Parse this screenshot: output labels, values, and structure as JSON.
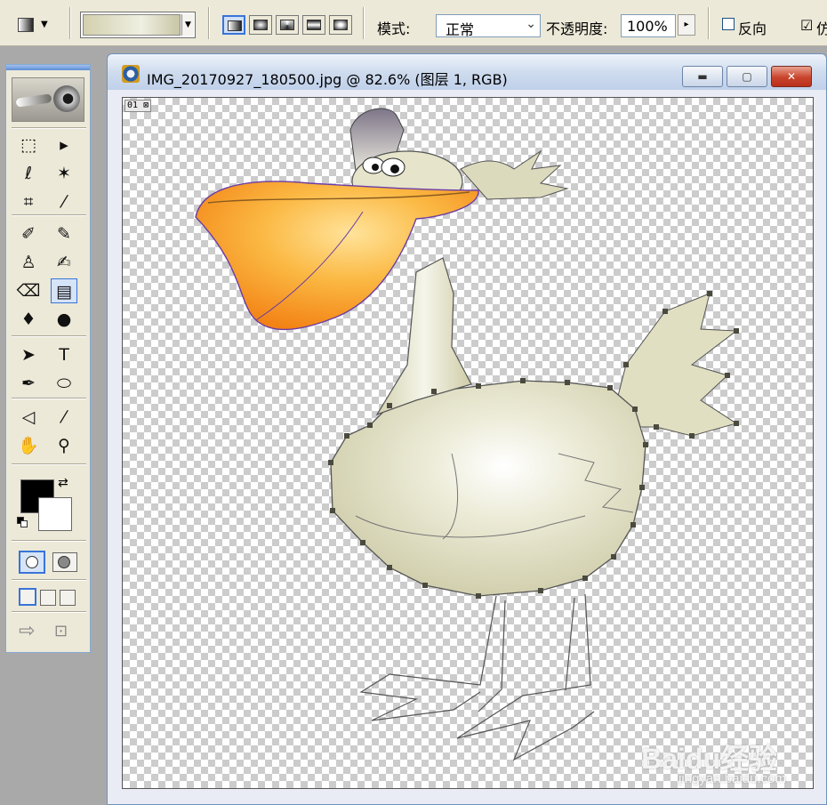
{
  "options_bar": {
    "mode_label": "模式:",
    "mode_value": "正常",
    "opacity_label": "不透明度:",
    "opacity_value": "100%",
    "reverse_label": "反向",
    "dither_checked_mark": "☑",
    "dither_partial": "仿"
  },
  "document": {
    "title": "IMG_20170927_180500.jpg @ 82.6% (图层 1, RGB)",
    "zoom_percent": 82.6,
    "layer_indicator": "01",
    "window_buttons": {
      "minimize": "▬",
      "maximize": "▢",
      "close": "✕"
    }
  },
  "toolbox": {
    "tools": [
      {
        "name": "marquee",
        "glyph": "⬚"
      },
      {
        "name": "move",
        "glyph": "▸"
      },
      {
        "name": "lasso",
        "glyph": "ℓ"
      },
      {
        "name": "magic-wand",
        "glyph": "✶"
      },
      {
        "name": "crop",
        "glyph": "⌗"
      },
      {
        "name": "slice",
        "glyph": "⁄"
      },
      {
        "name": "healing",
        "glyph": "✐"
      },
      {
        "name": "brush",
        "glyph": "✎"
      },
      {
        "name": "stamp",
        "glyph": "♙"
      },
      {
        "name": "history-brush",
        "glyph": "✍"
      },
      {
        "name": "eraser",
        "glyph": "⌫"
      },
      {
        "name": "gradient",
        "glyph": "▤"
      },
      {
        "name": "blur",
        "glyph": "♦"
      },
      {
        "name": "dodge",
        "glyph": "●"
      },
      {
        "name": "path-select",
        "glyph": "➤"
      },
      {
        "name": "type",
        "glyph": "T"
      },
      {
        "name": "pen",
        "glyph": "✒"
      },
      {
        "name": "shape",
        "glyph": "⬭"
      },
      {
        "name": "notes",
        "glyph": "◁"
      },
      {
        "name": "eyedropper",
        "glyph": "⁄"
      },
      {
        "name": "hand",
        "glyph": "✋"
      },
      {
        "name": "zoom",
        "glyph": "⚲"
      }
    ],
    "foreground_color": "#000000",
    "background_color": "#ffffff"
  },
  "watermark": {
    "brand": "Baidu经验",
    "url": "jingyan.baidu.com"
  },
  "colors": {
    "beak_orange": "#f7931e",
    "body_cream": "#e4e2c6",
    "ui_blue": "#3874d8"
  }
}
